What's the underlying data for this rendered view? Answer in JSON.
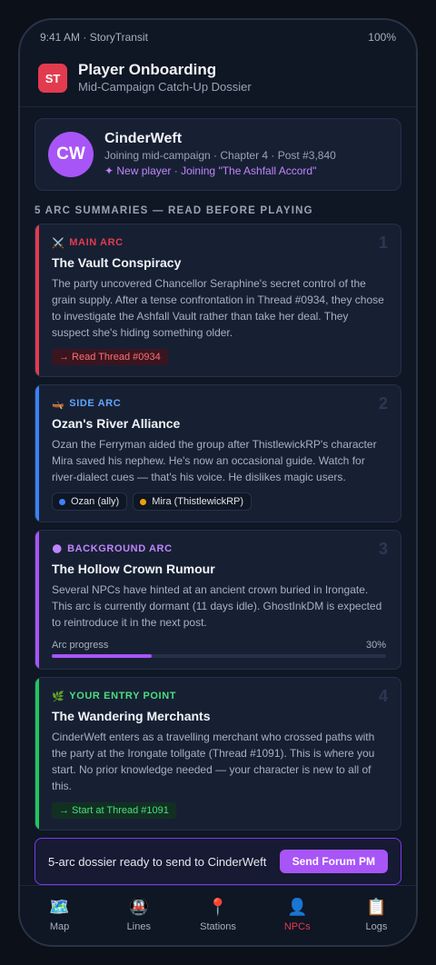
{
  "status": {
    "left": "9:41 AM · StoryTransit",
    "battery": "100%"
  },
  "header": {
    "logo": "ST",
    "title": "Player Onboarding",
    "subtitle": "Mid-Campaign Catch-Up Dossier"
  },
  "profile": {
    "initials": "CW",
    "name": "CinderWeft",
    "meta": "Joining mid-campaign · Chapter 4 · Post #3,840",
    "new_player": "✦ New player · Joining \"The Ashfall Accord\""
  },
  "section_title": "5 ARC SUMMARIES — READ BEFORE PLAYING",
  "arcs": [
    {
      "icon": "⚔️",
      "tag": "MAIN ARC",
      "num": "1",
      "title": "The Vault Conspiracy",
      "body": "The party uncovered Chancellor Seraphine's secret control of the grain supply. After a tense confrontation in Thread #0934, they chose to investigate the Ashfall Vault rather than take her deal. They suspect she's hiding something older.",
      "link": "→ Read Thread #0934",
      "accent": "#e23b4e"
    },
    {
      "icon": "🛶",
      "tag": "SIDE ARC",
      "num": "2",
      "title": "Ozan's River Alliance",
      "body": "Ozan the Ferryman aided the group after ThistlewickRP's character Mira saved his nephew. He's now an occasional guide. Watch for river-dialect cues — that's his voice. He dislikes magic users.",
      "chips": [
        {
          "label": "Ozan (ally)",
          "color": "#3b82f6"
        },
        {
          "label": "Mira (ThistlewickRP)",
          "color": "#f59e0b"
        }
      ],
      "accent": "#3b82f6"
    },
    {
      "icon": "🌑",
      "tag": "BACKGROUND ARC",
      "num": "3",
      "title": "The Hollow Crown Rumour",
      "body": "Several NPCs have hinted at an ancient crown buried in Irongate. This arc is currently dormant (11 days idle). GhostInkDM is expected to reintroduce it in the next post.",
      "progress_label": "Arc progress",
      "progress_text": "30%",
      "progress_value": 0.3,
      "accent": "#a855f7"
    },
    {
      "icon": "🌿",
      "tag": "YOUR ENTRY POINT",
      "num": "4",
      "title": "The Wandering Merchants",
      "body": "CinderWeft enters as a travelling merchant who crossed paths with the party at the Irongate tollgate (Thread #1091). This is where you start. No prior knowledge needed — your character is new to all of this.",
      "link": "→ Start at Thread #1091",
      "accent": "#22c55e"
    }
  ],
  "action": {
    "text": "5-arc dossier ready to send to CinderWeft",
    "button": "Send Forum PM"
  },
  "tabs": [
    {
      "icon": "🗺️",
      "label": "Map"
    },
    {
      "icon": "🚇",
      "label": "Lines"
    },
    {
      "icon": "📍",
      "label": "Stations"
    },
    {
      "icon": "👤",
      "label": "NPCs",
      "active": true
    },
    {
      "icon": "📋",
      "label": "Logs"
    }
  ],
  "colors": {
    "accent": "#a855f7",
    "brand": "#e23b4e",
    "background": "#0f1624"
  }
}
